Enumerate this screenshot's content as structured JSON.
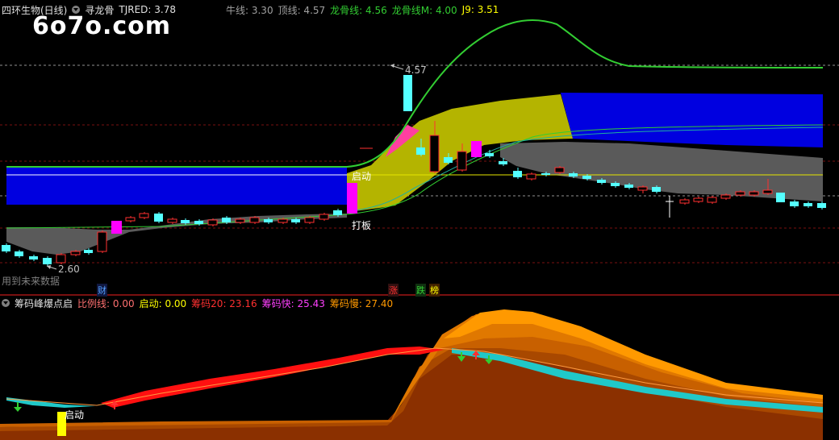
{
  "header": {
    "stock_title": "四环生物(日线)",
    "indicator_name": "寻龙骨",
    "tjred": "TJRED: 3.78",
    "niuxian": "牛线: 3.30",
    "dingxian": "顶线: 4.57",
    "longguxian": "龙骨线: 4.56",
    "longguxian_m": "龙骨线M: 4.00",
    "j9": "J9: 3.51"
  },
  "watermark": "6o7o.com",
  "main_annotations": {
    "high_label": "4.57",
    "low_label": "2.60",
    "qidong": "启动",
    "daban": "打板",
    "future_data": "用到未来数据"
  },
  "badges": {
    "cai": "财",
    "zhang": "涨",
    "die": "跌",
    "bang": "榜"
  },
  "sub_header": {
    "indicator_name": "筹码峰爆点启",
    "bili": "比例线: 0.00",
    "qidong": "启动: 0.00",
    "chouma20": "筹码20: 23.16",
    "chouma_kuai": "筹码快: 25.43",
    "chouma_man": "筹码慢: 27.40"
  },
  "sub_annotations": {
    "qidong": "启动"
  },
  "colors": {
    "background": "#000000",
    "up": "#ff3030",
    "down": "#54ffff",
    "magenta": "#ff00ff",
    "green_line": "#32cd32",
    "yellow_band": "#b4b400",
    "blue_band": "#0000e0",
    "gray_band": "#606060",
    "orange": "#ff9900"
  },
  "chart_data": {
    "type": "candlestick",
    "title": "四环生物(日线)",
    "price_range": [
      2.6,
      4.57
    ],
    "series": [
      {
        "name": "TJRED",
        "last": 3.78
      },
      {
        "name": "牛线",
        "last": 3.3
      },
      {
        "name": "顶线",
        "last": 4.57
      },
      {
        "name": "龙骨线",
        "last": 4.56
      },
      {
        "name": "龙骨线M",
        "last": 4.0
      },
      {
        "name": "J9",
        "last": 3.51
      }
    ],
    "sub_series": [
      {
        "name": "比例线",
        "last": 0.0
      },
      {
        "name": "启动",
        "last": 0.0
      },
      {
        "name": "筹码20",
        "last": 23.16
      },
      {
        "name": "筹码快",
        "last": 25.43
      },
      {
        "name": "筹码慢",
        "last": 27.4
      }
    ]
  }
}
